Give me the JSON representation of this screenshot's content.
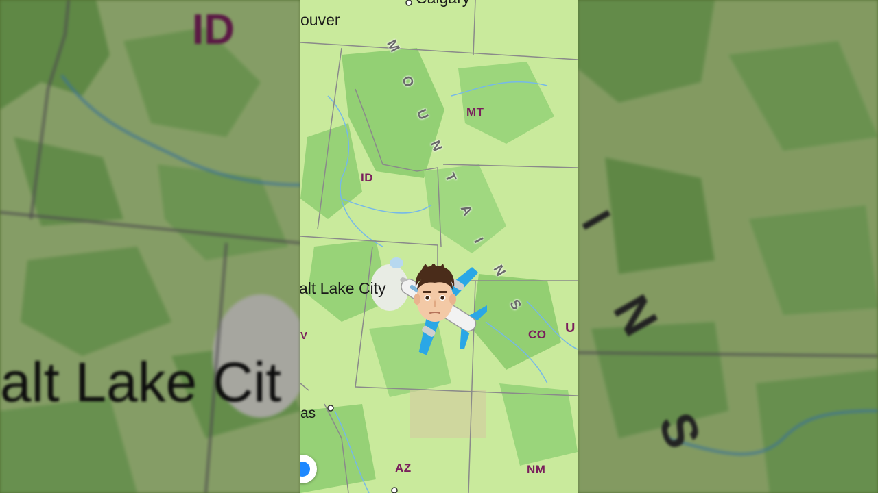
{
  "left_panel": {
    "state_label": "ID",
    "city_label": "alt Lake Cit"
  },
  "right_panel": {
    "mountain_letters": [
      "I",
      "N",
      "S"
    ]
  },
  "map": {
    "states": {
      "mt": "MT",
      "id": "ID",
      "co": "CO",
      "ut_partial": "U",
      "az": "AZ",
      "nm": "NM"
    },
    "cities": {
      "calgary_partial": "Calgary",
      "vancouver_partial": "ouver",
      "salt_lake_partial": "alt Lake City",
      "las_vegas_partial": "as",
      "west_partial": "V"
    },
    "mountain_range_letters": [
      "M",
      "O",
      "U",
      "N",
      "T",
      "A",
      "I",
      "N",
      "S"
    ],
    "avatar_icon": "memoji-man-face",
    "plane_icon": "airplane-icon",
    "location_button_icon": "current-location-icon",
    "colors": {
      "land": "#c9ea9c",
      "forest": "#8fcc6e",
      "state_label": "#7a1f5c",
      "border": "#8a8a8a",
      "plane_blue": "#2aa7e6"
    }
  }
}
